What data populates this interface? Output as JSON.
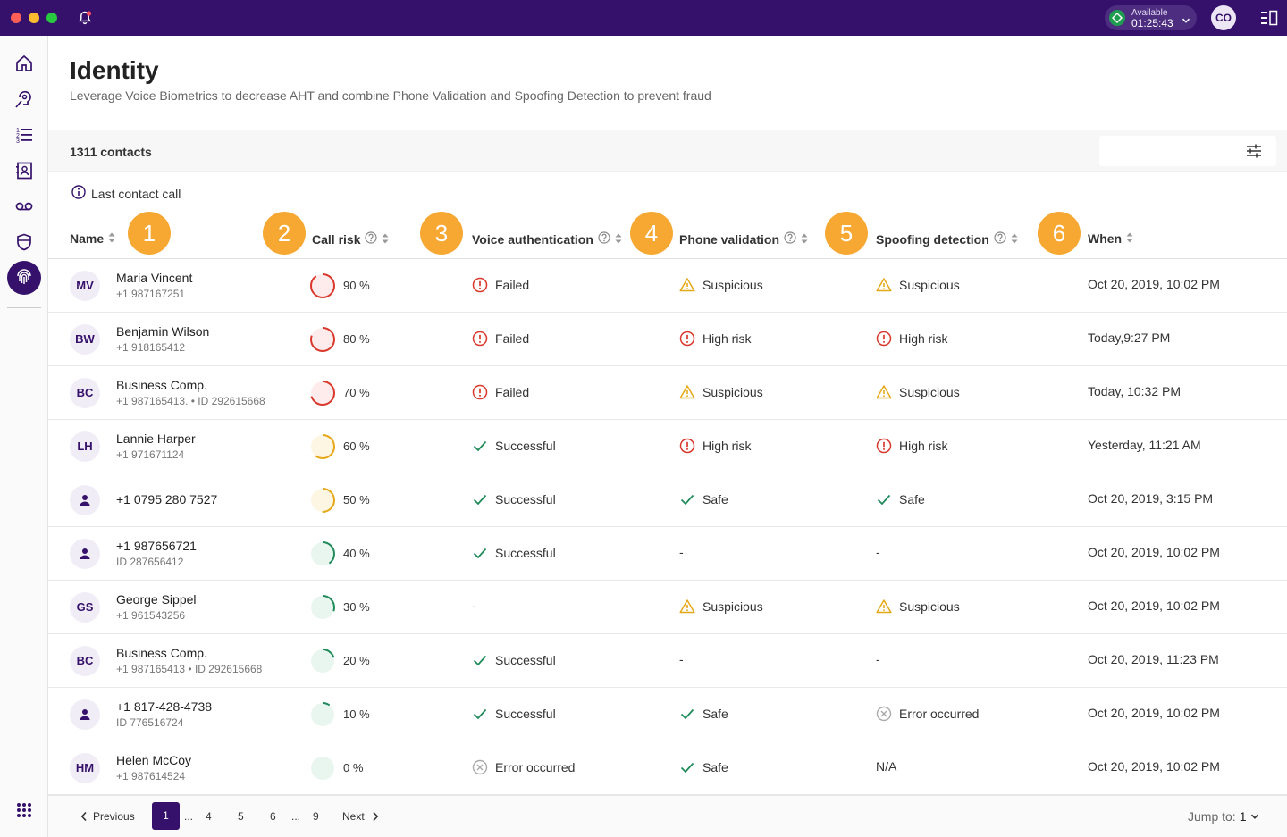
{
  "topbar": {
    "status_label": "Available",
    "status_time": "01:25:43",
    "avatar_initials": "CO"
  },
  "header": {
    "title": "Identity",
    "subtitle": "Leverage Voice Biometrics to decrease AHT and combine Phone Validation and Spoofing Detection to prevent fraud"
  },
  "toolbar": {
    "contacts_count": "1311 contacts",
    "last_call_label": "Last contact call"
  },
  "columns": {
    "name": "Name",
    "call_risk": "Call risk",
    "voice_auth": "Voice authentication",
    "phone_validation": "Phone validation",
    "spoofing": "Spoofing detection",
    "when": "When"
  },
  "badges": [
    "1",
    "2",
    "3",
    "4",
    "5",
    "6"
  ],
  "rows": [
    {
      "initials": "MV",
      "name": "Maria Vincent",
      "sub": "+1 987167251",
      "risk": 90,
      "risk_text": "90 %",
      "voice": {
        "status": "failed",
        "text": "Failed"
      },
      "phone": {
        "status": "warning",
        "text": "Suspicious"
      },
      "spoof": {
        "status": "warning",
        "text": "Suspicious"
      },
      "when": "Oct 20, 2019, 10:02 PM"
    },
    {
      "initials": "BW",
      "name": "Benjamin Wilson",
      "sub": "+1 918165412",
      "risk": 80,
      "risk_text": "80 %",
      "voice": {
        "status": "failed",
        "text": "Failed"
      },
      "phone": {
        "status": "failed",
        "text": "High risk"
      },
      "spoof": {
        "status": "failed",
        "text": "High risk"
      },
      "when": "Today,9:27 PM"
    },
    {
      "initials": "BC",
      "name": "Business Comp.",
      "sub": "+1 987165413.  •  ID 292615668",
      "risk": 70,
      "risk_text": "70 %",
      "voice": {
        "status": "failed",
        "text": "Failed"
      },
      "phone": {
        "status": "warning",
        "text": "Suspicious"
      },
      "spoof": {
        "status": "warning",
        "text": "Suspicious"
      },
      "when": "Today, 10:32 PM"
    },
    {
      "initials": "LH",
      "name": "Lannie Harper",
      "sub": "+1 971671124",
      "risk": 60,
      "risk_text": "60 %",
      "voice": {
        "status": "success",
        "text": "Successful"
      },
      "phone": {
        "status": "failed",
        "text": "High risk"
      },
      "spoof": {
        "status": "failed",
        "text": "High risk"
      },
      "when": "Yesterday, 11:21 AM"
    },
    {
      "initials": "",
      "name": "+1 0795 280 7527",
      "sub": "",
      "risk": 50,
      "risk_text": "50 %",
      "voice": {
        "status": "success",
        "text": "Successful"
      },
      "phone": {
        "status": "success",
        "text": "Safe"
      },
      "spoof": {
        "status": "success",
        "text": "Safe"
      },
      "when": "Oct 20, 2019, 3:15 PM"
    },
    {
      "initials": "",
      "name": "+1 987656721",
      "sub": "ID 287656412",
      "risk": 40,
      "risk_text": "40 %",
      "voice": {
        "status": "success",
        "text": "Successful"
      },
      "phone": {
        "status": "none",
        "text": "-"
      },
      "spoof": {
        "status": "none",
        "text": "-"
      },
      "when": "Oct 20, 2019, 10:02 PM"
    },
    {
      "initials": "GS",
      "name": "George Sippel",
      "sub": "+1 961543256",
      "risk": 30,
      "risk_text": "30 %",
      "voice": {
        "status": "none",
        "text": "-"
      },
      "phone": {
        "status": "warning",
        "text": "Suspicious"
      },
      "spoof": {
        "status": "warning",
        "text": "Suspicious"
      },
      "when": "Oct 20, 2019, 10:02 PM"
    },
    {
      "initials": "BC",
      "name": "Business Comp.",
      "sub": "+1 987165413  •  ID 292615668",
      "risk": 20,
      "risk_text": "20 %",
      "voice": {
        "status": "success",
        "text": "Successful"
      },
      "phone": {
        "status": "none",
        "text": "-"
      },
      "spoof": {
        "status": "none",
        "text": "-"
      },
      "when": "Oct 20, 2019, 11:23 PM"
    },
    {
      "initials": "",
      "name": "+1 817-428-4738",
      "sub": "ID 776516724",
      "risk": 10,
      "risk_text": "10 %",
      "voice": {
        "status": "success",
        "text": "Successful"
      },
      "phone": {
        "status": "success",
        "text": "Safe"
      },
      "spoof": {
        "status": "error",
        "text": "Error occurred"
      },
      "when": "Oct 20, 2019, 10:02 PM"
    },
    {
      "initials": "HM",
      "name": "Helen McCoy",
      "sub": "+1 987614524",
      "risk": 0,
      "risk_text": "0 %",
      "voice": {
        "status": "error",
        "text": "Error occurred"
      },
      "phone": {
        "status": "success",
        "text": "Safe"
      },
      "spoof": {
        "status": "none",
        "text": "N/A"
      },
      "when": "Oct 20, 2019, 10:02 PM"
    }
  ],
  "pagination": {
    "previous": "Previous",
    "current": "1",
    "ellipsis": "...",
    "pages": [
      "4",
      "5",
      "6"
    ],
    "last": "9",
    "next": "Next",
    "jump_label": "Jump to:",
    "jump_value": "1"
  },
  "colors": {
    "brand": "#35116b",
    "badge": "#f7a833",
    "danger": "#d9382c",
    "warning": "#e6a818",
    "success": "#1f8a5a",
    "neutral": "#aaaaaa"
  }
}
